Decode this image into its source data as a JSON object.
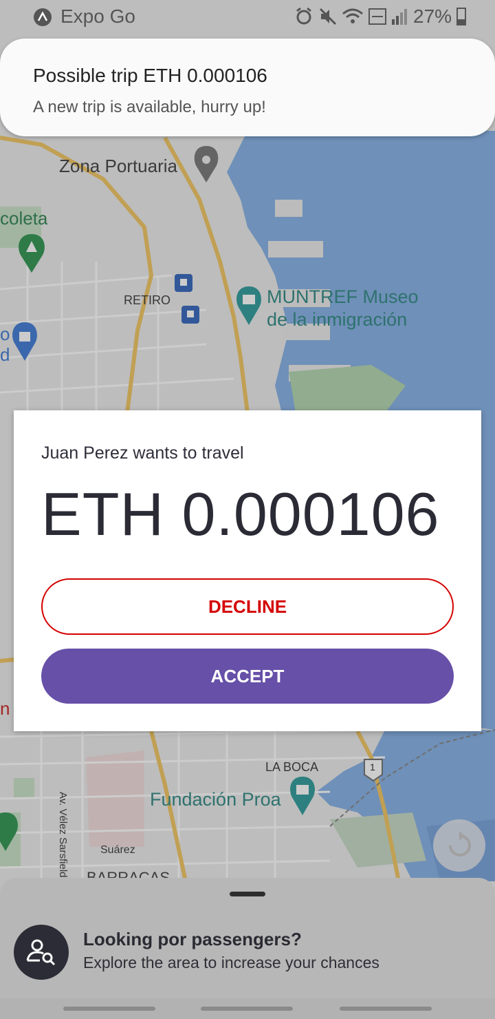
{
  "status_bar": {
    "app_name": "Expo Go",
    "battery": "27%"
  },
  "notification": {
    "title": "Possible trip ETH 0.000106",
    "body": "A new trip is available, hurry up!"
  },
  "map": {
    "labels": {
      "zona_portuaria": "Zona Portuaria",
      "recoleta": "coleta",
      "retiro": "RETIRO",
      "muntref_1": "MUNTREF Museo",
      "muntref_2": "de la inmigración",
      "la_boca": "LA BOCA",
      "fundacion_proa": "Fundación Proa",
      "velez": "Av. Vélez Sarsfield",
      "suarez": "Suárez",
      "barracas": "BARRACAS",
      "route_1": "1",
      "left_edge_1": "o",
      "left_edge_2": "d",
      "left_edge_3": "n"
    }
  },
  "trip_modal": {
    "requester": "Juan Perez wants to travel",
    "amount": "ETH 0.000106",
    "decline_label": "DECLINE",
    "accept_label": "ACCEPT"
  },
  "bottom_sheet": {
    "headline": "Looking por passengers?",
    "subtext": "Explore the area to increase your chances"
  },
  "colors": {
    "accent": "#6650a8",
    "decline": "#d40000",
    "water": "#8bb4e6"
  }
}
